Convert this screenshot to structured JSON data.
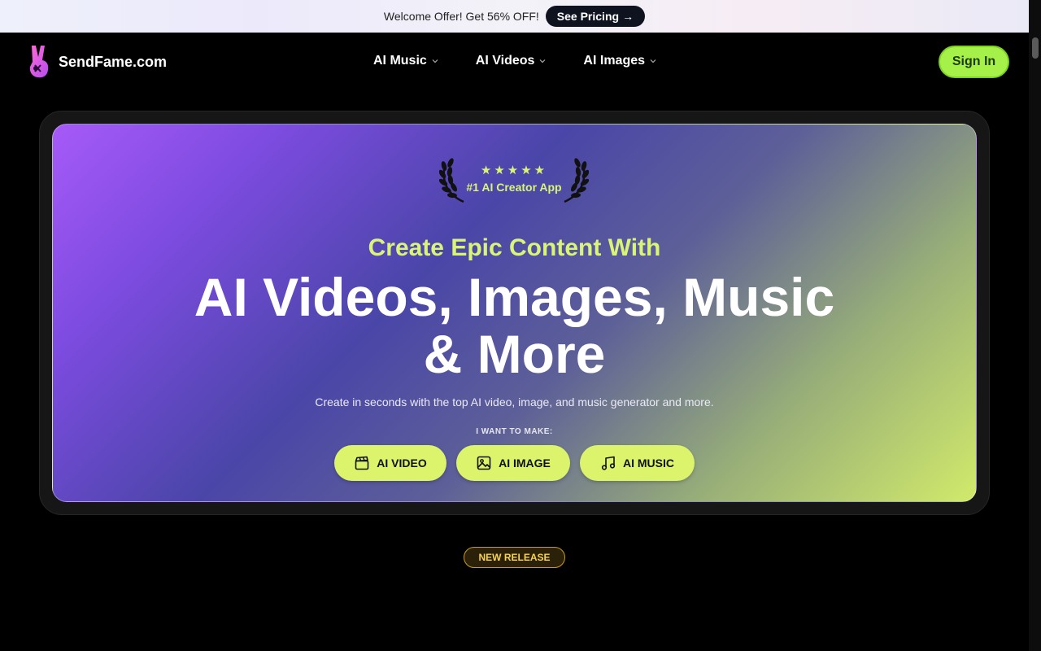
{
  "promo": {
    "text": "Welcome Offer! Get 56% OFF!",
    "button_label": "See Pricing",
    "button_arrow": "→"
  },
  "brand": {
    "name": "SendFame.com",
    "logo_icon": "peace-hand-icon"
  },
  "nav": {
    "items": [
      {
        "label": "AI Music"
      },
      {
        "label": "AI Videos"
      },
      {
        "label": "AI Images"
      }
    ],
    "signin_label": "Sign In"
  },
  "hero": {
    "award_stars": "★★★★★",
    "award_text": "#1 AI Creator App",
    "kicker": "Create Epic Content With",
    "headline_line1": "AI Videos, Images, Music",
    "headline_line2": "& More",
    "subtitle": "Create in seconds with the top AI video, image, and music generator and more.",
    "make_label": "I WANT TO MAKE:",
    "ctas": [
      {
        "label": "AI VIDEO",
        "icon": "clapperboard-icon"
      },
      {
        "label": "AI IMAGE",
        "icon": "image-icon"
      },
      {
        "label": "AI MUSIC",
        "icon": "music-note-icon"
      }
    ]
  },
  "badge": {
    "label": "NEW RELEASE"
  },
  "colors": {
    "accent_lime": "#dcf46b",
    "signin_green": "#a6f04a",
    "gold": "#f8d34e"
  }
}
